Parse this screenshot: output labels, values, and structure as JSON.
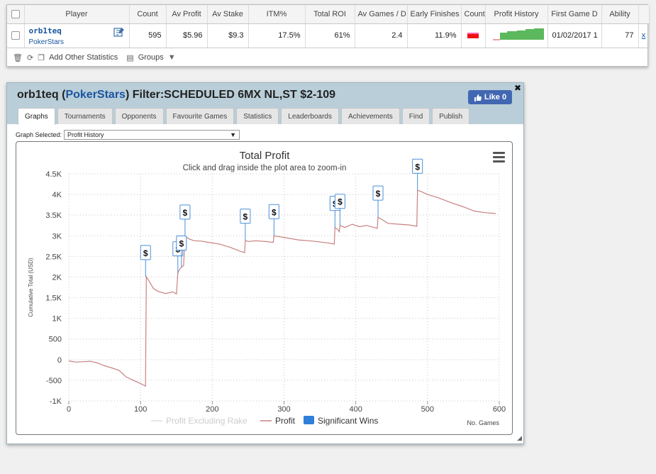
{
  "stats": {
    "headers": [
      "Player",
      "Count",
      "Av Profit",
      "Av Stake",
      "ITM%",
      "Total ROI",
      "Av Games / D",
      "Early Finishes",
      "Count",
      "Profit History",
      "First Game D",
      "Ability"
    ],
    "row": {
      "player": "orb1teq",
      "site": "PokerStars",
      "count": "595",
      "av_profit": "$5.96",
      "av_stake": "$9.3",
      "itm": "17.5%",
      "total_roi": "61%",
      "av_games": "2.4",
      "early_finishes": "11.9%",
      "first_game": "01/02/2017 1",
      "ability": "77",
      "x": "x"
    },
    "toolbar": {
      "add_label": "Add Other Statistics",
      "groups_label": "Groups"
    }
  },
  "panel": {
    "title_player": "orb1teq",
    "title_site": "PokerStars",
    "title_filter": "Filter:SCHEDULED 6MX NL,ST $2-109",
    "like_label": "Like 0",
    "close_label": "✖",
    "tabs": [
      "Graphs",
      "Tournaments",
      "Opponents",
      "Favourite Games",
      "Statistics",
      "Leaderboards",
      "Achievements",
      "Find",
      "Publish"
    ],
    "graph_selected_label": "Graph Selected:",
    "graph_selected_value": "Profit History"
  },
  "chart_data": {
    "type": "line",
    "title": "Total Profit",
    "subtitle": "Click and drag inside the plot area to zoom-in",
    "ylabel": "Cumulative Total (USD)",
    "xlabel": "No. Games",
    "xlim": [
      0,
      600
    ],
    "ylim": [
      -1000,
      4500
    ],
    "xticks": [
      0,
      100,
      200,
      300,
      400,
      500,
      600
    ],
    "yticks": [
      -1000,
      -500,
      0,
      500,
      1000,
      1500,
      2000,
      2500,
      3000,
      3500,
      4000,
      4500
    ],
    "ytick_labels": [
      "-1K",
      "-500",
      "0",
      "500",
      "1K",
      "1.5K",
      "2K",
      "2.5K",
      "3K",
      "3.5K",
      "4K",
      "4.5K"
    ],
    "legend": [
      "Profit Excluding Rake",
      "Profit",
      "Significant Wins"
    ],
    "series": [
      {
        "name": "Profit",
        "color": "#c88080",
        "x": [
          0,
          10,
          20,
          30,
          40,
          50,
          60,
          70,
          80,
          90,
          100,
          107,
          108,
          112,
          118,
          125,
          135,
          145,
          150,
          152,
          155,
          157,
          160,
          162,
          168,
          175,
          185,
          195,
          210,
          225,
          240,
          245,
          246,
          250,
          260,
          275,
          285,
          286,
          300,
          320,
          340,
          360,
          370,
          371,
          375,
          377,
          378,
          385,
          395,
          405,
          415,
          430,
          431,
          438,
          445,
          460,
          475,
          485,
          486,
          490,
          500,
          515,
          530,
          550,
          565,
          580,
          595
        ],
        "y": [
          -30,
          -60,
          -50,
          -40,
          -80,
          -150,
          -200,
          -260,
          -420,
          -500,
          -580,
          -640,
          2010,
          1900,
          1720,
          1650,
          1600,
          1640,
          1590,
          2100,
          2200,
          2240,
          2280,
          2990,
          2920,
          2880,
          2870,
          2840,
          2800,
          2720,
          2620,
          2590,
          2890,
          2860,
          2880,
          2860,
          2840,
          3000,
          2960,
          2900,
          2870,
          2830,
          2800,
          3200,
          3150,
          3100,
          3250,
          3200,
          3280,
          3220,
          3250,
          3180,
          3450,
          3380,
          3300,
          3280,
          3260,
          3230,
          4100,
          4080,
          4000,
          3920,
          3820,
          3700,
          3600,
          3560,
          3540
        ]
      }
    ],
    "significant_wins": [
      {
        "x": 107,
        "y": 2010,
        "label": "$"
      },
      {
        "x": 152,
        "y": 2100,
        "label": "$"
      },
      {
        "x": 157,
        "y": 2240,
        "label": "$"
      },
      {
        "x": 162,
        "y": 2990,
        "label": "$"
      },
      {
        "x": 246,
        "y": 2890,
        "label": "$"
      },
      {
        "x": 286,
        "y": 3000,
        "label": "$"
      },
      {
        "x": 371,
        "y": 3200,
        "label": "$"
      },
      {
        "x": 378,
        "y": 3250,
        "label": "$"
      },
      {
        "x": 431,
        "y": 3450,
        "label": "$"
      },
      {
        "x": 486,
        "y": 4100,
        "label": "$"
      }
    ]
  }
}
